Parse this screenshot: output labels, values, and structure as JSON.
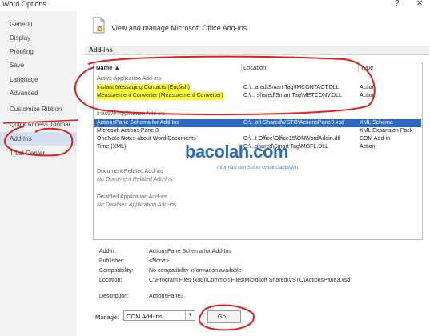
{
  "window": {
    "title": "Word Options",
    "help": "?",
    "close": "✕"
  },
  "sidebar": {
    "items": [
      {
        "label": "General",
        "active": false
      },
      {
        "label": "Display",
        "active": false
      },
      {
        "label": "Proofing",
        "active": false
      },
      {
        "label": "Save",
        "active": false
      },
      {
        "label": "Language",
        "active": false
      },
      {
        "label": "Advanced",
        "active": false
      },
      {
        "label": "Customize Ribbon",
        "active": false
      },
      {
        "label": "Quick Access Toolbar",
        "active": false
      },
      {
        "label": "Add-Ins",
        "active": true
      },
      {
        "label": "Trust Center",
        "active": false
      }
    ]
  },
  "main": {
    "header": "View and manage Microsoft Office Add-ins.",
    "section_title": "Add-ins",
    "columns": {
      "name": "Name ▲",
      "location": "Location",
      "type": "Type"
    },
    "groups": {
      "active": "Active Application Add-ins",
      "inactive": "Inactive Application Add-ins",
      "document": "Document Related Add-ins",
      "disabled": "Disabled Application Add-ins"
    },
    "active_rows": [
      {
        "name": "Instant Messaging Contacts (English)",
        "location": "C:\\...ared\\Smart Tag\\IMCONTACT.DLL",
        "type": "Action"
      },
      {
        "name": "Measurement Converter (Measurement Converter)",
        "location": "C:\\... shared\\Smart Tag\\METCONV.DLL",
        "type": "Action"
      }
    ],
    "inactive_rows": [
      {
        "name": "ActionsPane Schema for Add-Ins",
        "location": "C:\\...oft Shared\\VSTO\\ActionsPane3.xsd",
        "type": "XML Schema"
      },
      {
        "name": "Microsoft Actions Pane 3",
        "location": "",
        "type": "XML Expansion Pack"
      },
      {
        "name": "OneNote Notes about Word Documents",
        "location": "C:\\...t Office\\Office15\\ONWordAddin.dll",
        "type": "COM Add-in"
      },
      {
        "name": "Time (XML)",
        "location": "C:\\...shared\\Smart Tag\\MOFL.DLL",
        "type": "Action"
      }
    ],
    "document_empty": "No Document Related Add-ins",
    "disabled_empty": "No Disabled Application Add-ins",
    "details": [
      {
        "label": "Add-in:",
        "value": "ActionsPane Schema for Add-Ins"
      },
      {
        "label": "Publisher:",
        "value": "<None>"
      },
      {
        "label": "Compatibility:",
        "value": "No compatibility information available"
      },
      {
        "label": "Location:",
        "value": "C:\\Program Files (x86)\\Common Files\\Microsoft Shared\\VSTO\\ActionsPane3.xsd"
      },
      {
        "label": "Description:",
        "value": "ActionsPane3"
      }
    ],
    "manage_label": "Manage:",
    "manage_value": "COM Add-ins",
    "go_label": "Go..."
  },
  "watermark": {
    "brand": "bacolah.com",
    "tagline": "Informasi dan Solusi Untuk GadgetMu"
  },
  "colors": {
    "selection": "#2b6ac4",
    "highlight": "#ffff33",
    "annotation": "#e0201a"
  }
}
